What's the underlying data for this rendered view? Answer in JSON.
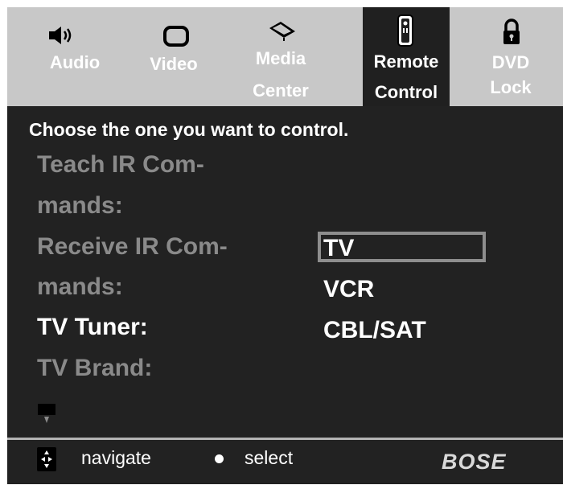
{
  "tabs": [
    {
      "line1": "Audio",
      "line2": "",
      "icon": "speaker-icon",
      "active": false
    },
    {
      "line1": "Video",
      "line2": "",
      "icon": "tv-screen-icon",
      "active": false
    },
    {
      "line1": "Media",
      "line2": "Center",
      "icon": "media-center-icon",
      "active": false
    },
    {
      "line1": "Remote",
      "line2": "Control",
      "icon": "remote-icon",
      "active": true
    },
    {
      "line1": "DVD",
      "line2": "Lock",
      "icon": "lock-icon",
      "active": false
    }
  ],
  "main": {
    "prompt": "Choose the one you want to control.",
    "labels": [
      "Teach IR Com-",
      "mands:",
      "Receive IR Com-",
      "mands:",
      "TV Tuner:",
      "TV Brand:"
    ],
    "options": [
      "TV",
      "VCR",
      "CBL/SAT"
    ],
    "selected_option": "TV"
  },
  "footer": {
    "navigate_label": "navigate",
    "select_label": "select",
    "brand": "BOSE"
  },
  "colors": {
    "panel": "#222222",
    "tabbar": "#c8c8c8",
    "dim_text": "#8a8a8a",
    "highlight_border": "#8e8e8e"
  }
}
